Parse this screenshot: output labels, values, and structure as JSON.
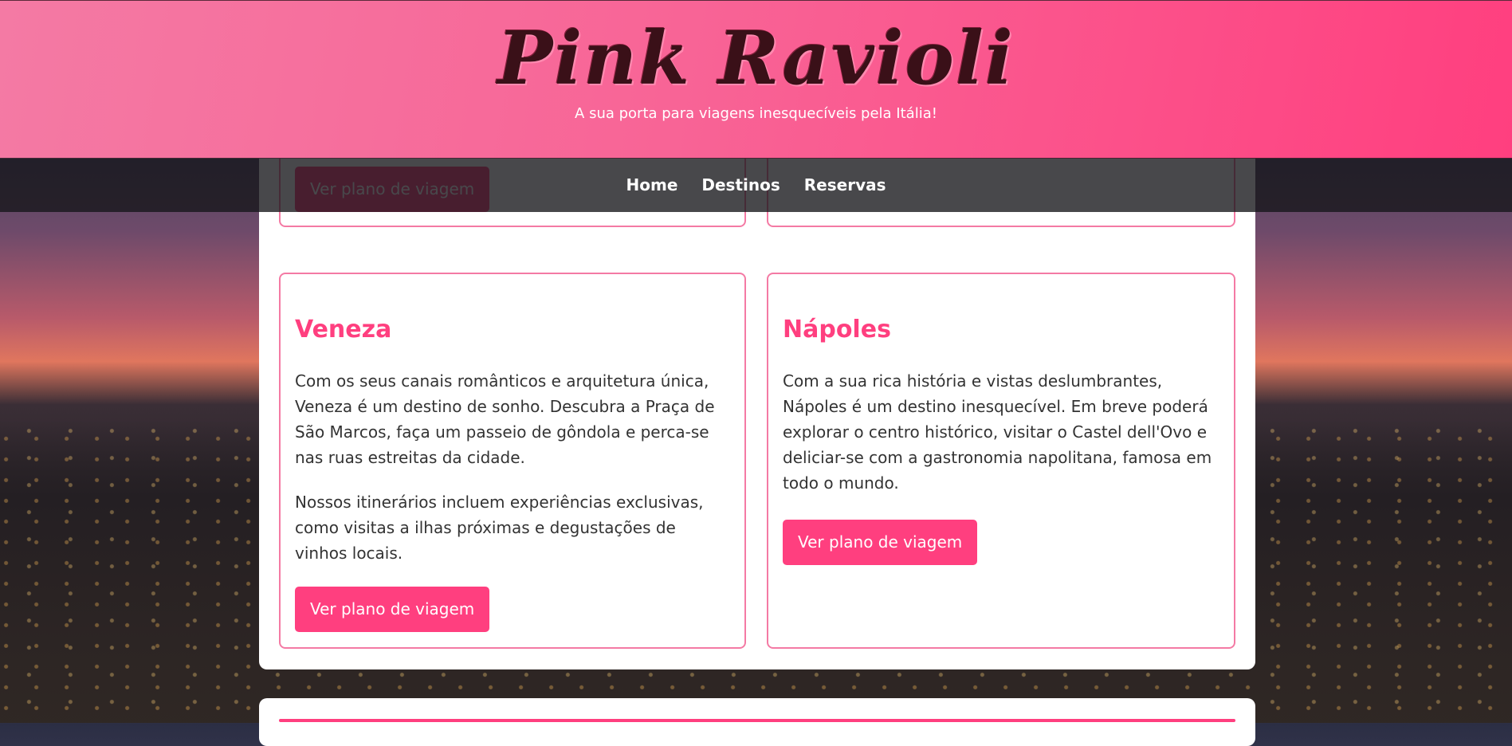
{
  "header": {
    "logo": "Pink Ravioli",
    "tagline": "A sua porta para viagens inesquecíveis pela Itália!"
  },
  "nav": {
    "items": [
      "Home",
      "Destinos",
      "Reservas"
    ]
  },
  "destinations": {
    "button_label": "Ver plano de viagem",
    "veneza": {
      "title": "Veneza",
      "paragraph1": "Com os seus canais românticos e arquitetura única, Veneza é um destino de sonho. Descubra a Praça de São Marcos, faça um passeio de gôndola e perca-se nas ruas estreitas da cidade.",
      "paragraph2": "Nossos itinerários incluem experiências exclusivas, como visitas a ilhas próximas e degustações de vinhos locais."
    },
    "napoles": {
      "title": "Nápoles",
      "paragraph1": "Com a sua rica história e vistas deslumbrantes, Nápoles é um destino inesquecível. Em breve poderá explorar o centro histórico, visitar o Castel dell'Ovo e deliciar-se com a gastronomia napolitana, famosa em todo o mundo."
    }
  },
  "colors": {
    "accent": "#ff3f7f",
    "header_light": "#f47aa4",
    "nav_bg": "#141418"
  }
}
